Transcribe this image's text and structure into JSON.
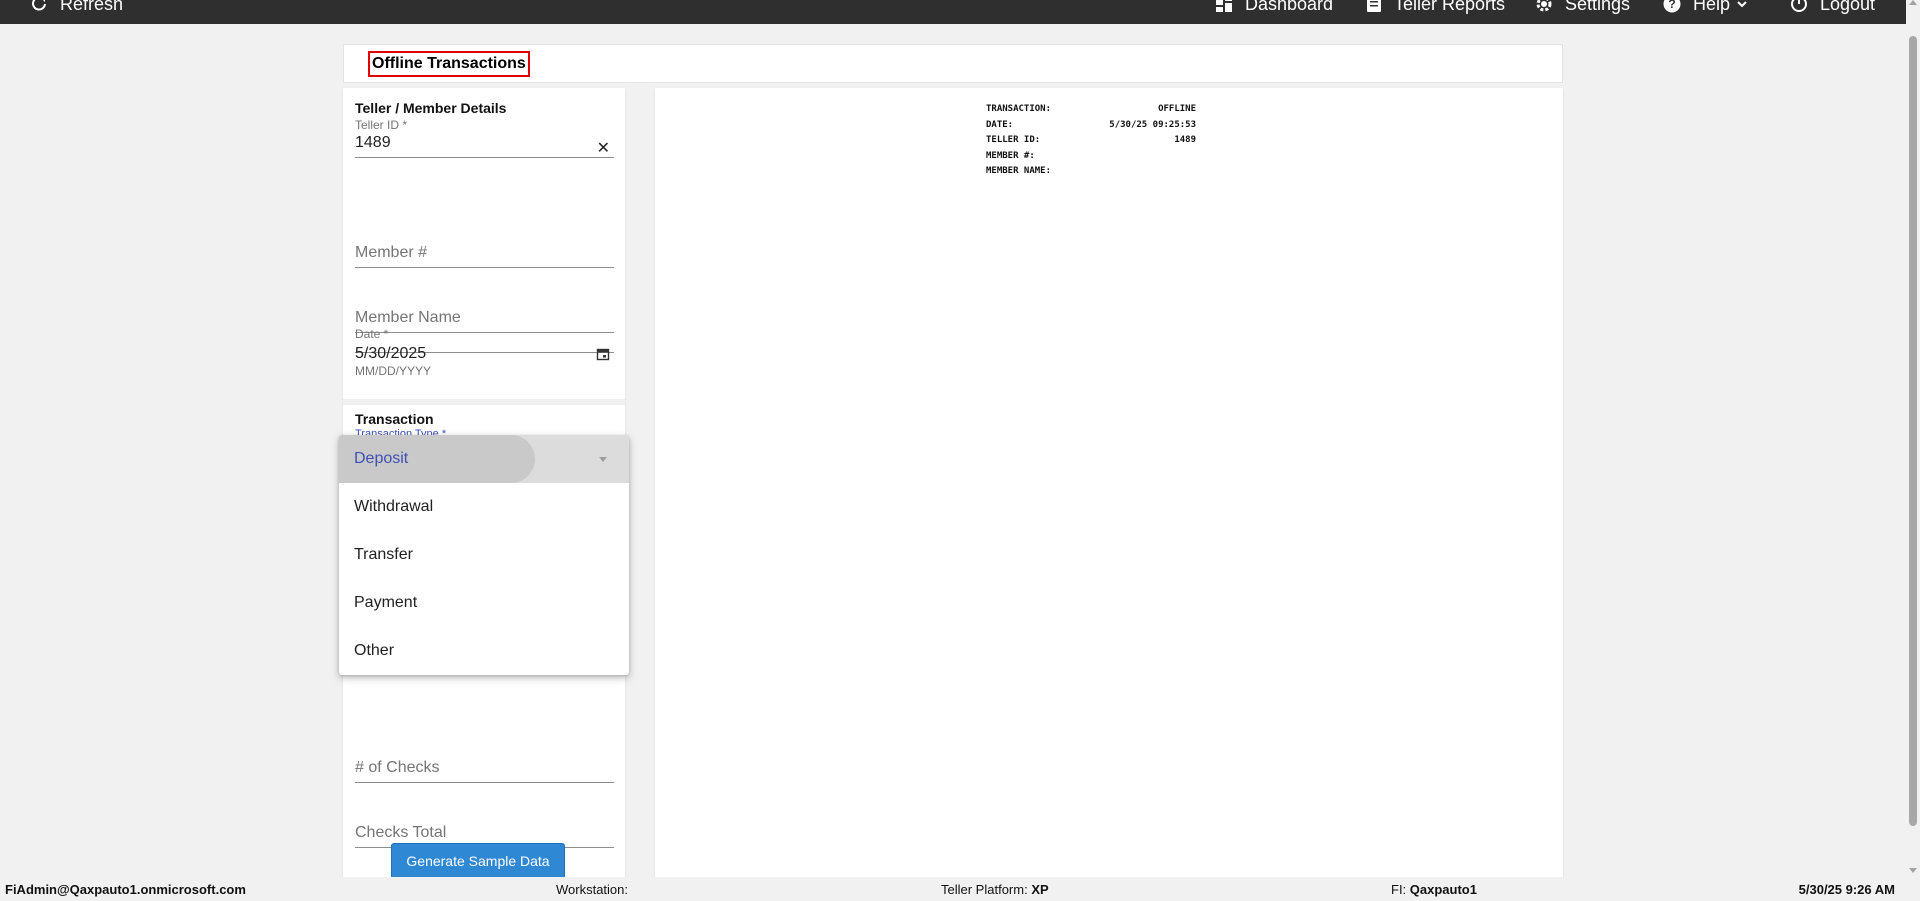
{
  "topbar": {
    "refresh_label": "Refresh",
    "dashboard_label": "Dashboard",
    "reports_label": "Teller Reports",
    "settings_label": "Settings",
    "help_label": "Help",
    "logout_label": "Logout"
  },
  "page": {
    "title": "Offline Transactions"
  },
  "teller_section": {
    "title": "Teller / Member Details",
    "teller_id": {
      "label": "Teller ID *",
      "value": "1489"
    },
    "member_number": {
      "placeholder": "Member #"
    },
    "member_name": {
      "placeholder": "Member Name"
    },
    "date": {
      "label": "Date *",
      "value": "5/30/2025",
      "helper": "MM/DD/YYYY"
    }
  },
  "transaction_section": {
    "title": "Transaction",
    "type_label": "Transaction Type *",
    "checks_count": {
      "placeholder": "# of Checks"
    },
    "checks_total": {
      "placeholder": "Checks Total"
    },
    "generate_button": "Generate Sample Data"
  },
  "dropdown": {
    "options": [
      "Deposit",
      "Withdrawal",
      "Transfer",
      "Payment",
      "Other"
    ],
    "selected": "Deposit"
  },
  "receipt": {
    "rows": [
      {
        "key": "TRANSACTION:",
        "value": "OFFLINE"
      },
      {
        "key": "DATE:",
        "value": "5/30/25 09:25:53"
      },
      {
        "key": "TELLER ID:",
        "value": "1489"
      },
      {
        "key": "MEMBER #:",
        "value": ""
      },
      {
        "key": "MEMBER NAME:",
        "value": ""
      }
    ]
  },
  "statusbar": {
    "user": "FiAdmin@Qaxpauto1.onmicrosoft.com",
    "workstation_label": "Workstation:",
    "workstation_value": "",
    "platform_label": "Teller Platform:",
    "platform_value": "XP",
    "fi_label": "FI:",
    "fi_value": "Qaxpauto1",
    "datetime": "5/30/25 9:26 AM"
  },
  "colors": {
    "topbar": "#2f2f2f",
    "accent": "#2f88d4",
    "selected_text": "#3f51b5",
    "title_border": "#e00000"
  }
}
